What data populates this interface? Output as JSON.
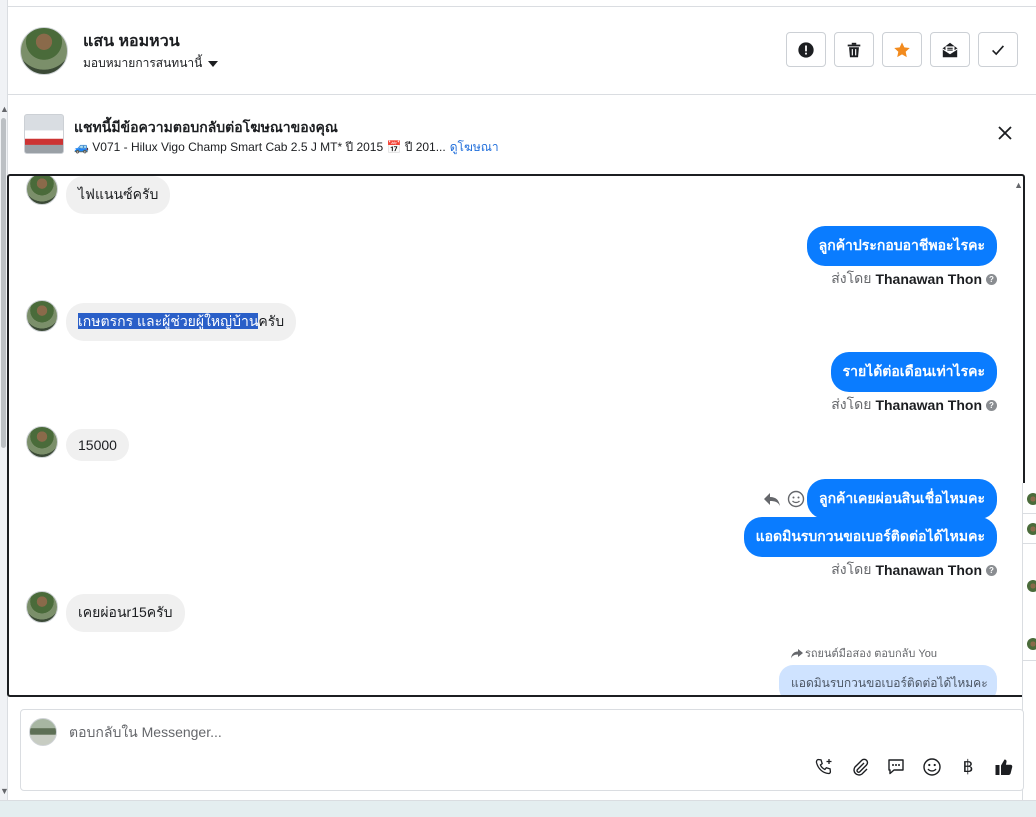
{
  "header": {
    "name": "แสน หอมหวน",
    "assign_label": "มอบหมายการสนทนานี้",
    "actions": [
      "spam-report",
      "delete",
      "star",
      "mark-unread",
      "mark-done"
    ]
  },
  "ad_banner": {
    "title": "แชทนี้มีข้อความตอบกลับต่อโฆษณาของคุณ",
    "detail": "🚙 V071 - Hilux Vigo Champ Smart Cab 2.5 J MT* ปี 2015 📅 ปี 201...",
    "link": "ดูโฆษณา"
  },
  "messages": [
    {
      "dir": "in",
      "text": "ไฟแนนซ์ครับ"
    },
    {
      "dir": "out",
      "text": "ลูกค้าประกอบอาชีพอะไรคะ",
      "sent_prefix": "ส่งโดย",
      "sent_by": "Thanawan Thon"
    },
    {
      "dir": "in",
      "text_selected": "เกษตรกร และผู้ช่วยผู้ใหญ่บ้าน",
      "text_rest": "ครับ"
    },
    {
      "dir": "out",
      "text": "รายได้ต่อเดือนเท่าไรคะ",
      "sent_prefix": "ส่งโดย",
      "sent_by": "Thanawan Thon"
    },
    {
      "dir": "in",
      "text": "15000"
    },
    {
      "dir": "out",
      "text": "ลูกค้าเคยผ่อนสินเชื่อไหมคะ"
    },
    {
      "dir": "out",
      "text": "แอดมินรบกวนขอเบอร์ติดต่อได้ไหมคะ",
      "sent_prefix": "ส่งโดย",
      "sent_by": "Thanawan Thon"
    },
    {
      "dir": "in",
      "text": "เคยผ่อนr15ครับ"
    }
  ],
  "reply_preview": {
    "note": "รถยนต์มือสอง ตอบกลับ You",
    "quoted": "แอดมินรบกวนขอเบอร์ติดต่อได้ไหมคะ"
  },
  "composer": {
    "placeholder": "ตอบกลับใน Messenger...",
    "tools": [
      "call-add",
      "attach",
      "saved-reply",
      "emoji",
      "baht",
      "like"
    ],
    "baht_symbol": "฿"
  },
  "colors": {
    "accent": "#0a7cff",
    "star": "#f28b1e",
    "selection": "#2a5fc8"
  }
}
